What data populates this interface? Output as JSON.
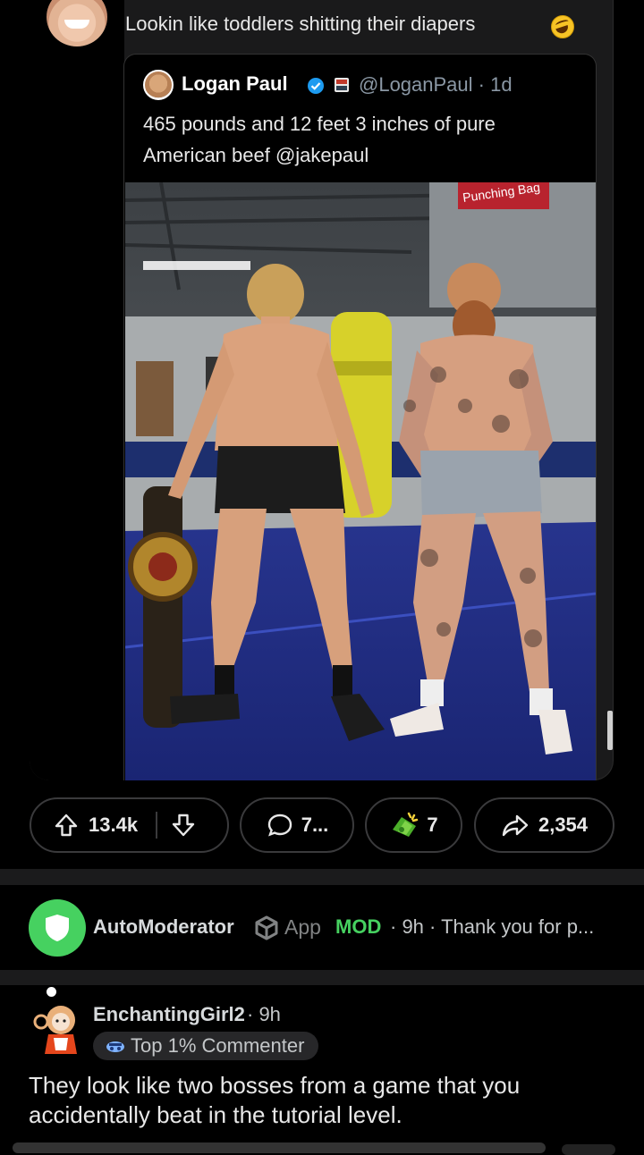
{
  "post": {
    "text": "Lookin like toddlers shitting their diapers",
    "emoji": "rolling-on-floor-laughing-emoji"
  },
  "tweet": {
    "name": "Logan Paul",
    "handle_time": "@LoganPaul · 1d",
    "body": "465 pounds and 12 feet 3 inches of pure American beef @jakepaul",
    "photo_sign": "Punching Bag"
  },
  "actions": {
    "upvotes": "13.4k",
    "comments": "7...",
    "awards": "7",
    "shares": "2,354"
  },
  "automod": {
    "name": "AutoModerator",
    "app_label": "App",
    "mod_label": "MOD",
    "meta": "· 9h · Thank you for p..."
  },
  "comment": {
    "user": "EnchantingGirl2",
    "time": "· 9h",
    "badge": "Top 1% Commenter",
    "text": "They look like two bosses from a game that you accidentally beat in the tutorial level."
  },
  "colors": {
    "background": "#000000",
    "card": "#1a1a1b",
    "mod_green": "#46d160",
    "verified_blue": "#1d9bf0"
  }
}
